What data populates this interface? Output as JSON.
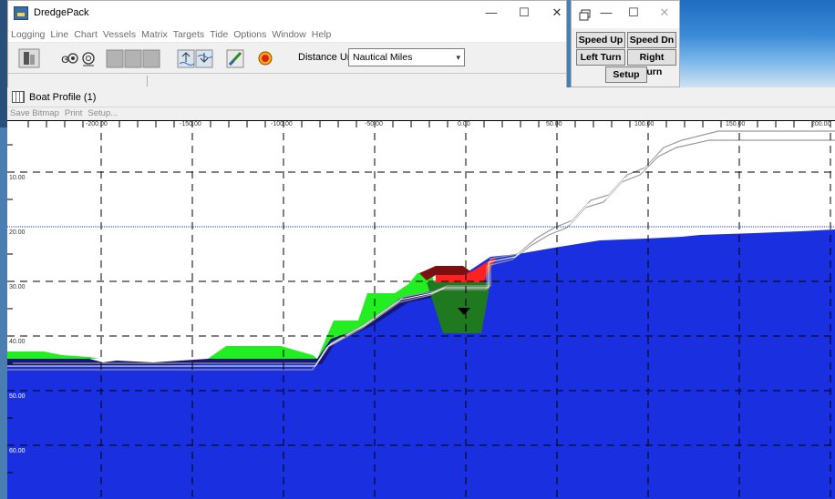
{
  "main_window": {
    "title": "DredgePack",
    "controls": [
      "—",
      "☐",
      "✕"
    ],
    "menu": [
      "Logging",
      "Line",
      "Chart",
      "Vessels",
      "Matrix",
      "Targets",
      "Tide",
      "Options",
      "Window",
      "Help"
    ],
    "distance_unit_label": "Distance Unit",
    "distance_unit_value": "Nautical Miles"
  },
  "speed_window": {
    "controls": [
      "—",
      "☐",
      "✕"
    ],
    "buttons": {
      "speed_up": "Speed Up",
      "speed_dn": "Speed Dn",
      "left_turn": "Left Turn",
      "right_turn": "Right Turn",
      "setup": "Setup"
    }
  },
  "profile_window": {
    "title": "Boat Profile (1)",
    "menu": [
      "Save Bitmap",
      "Print",
      "Setup..."
    ],
    "x_ticks": [
      "-200.00",
      "-150.00",
      "-100.00",
      "-50.00",
      "0.00",
      "50.00",
      "100.00",
      "150.00",
      "200.00"
    ],
    "y_ticks": [
      "10.00",
      "20.00",
      "30.00",
      "40.00",
      "50.00",
      "60.00"
    ]
  },
  "colors": {
    "water_blue": "#1a2fe0",
    "dark_navy": "#1a1a7a",
    "green": "#22ee22",
    "dark_green": "#1f7a1f",
    "red": "#ff2020",
    "dark_red": "#7a1010",
    "tide_line": "#3030c0"
  }
}
